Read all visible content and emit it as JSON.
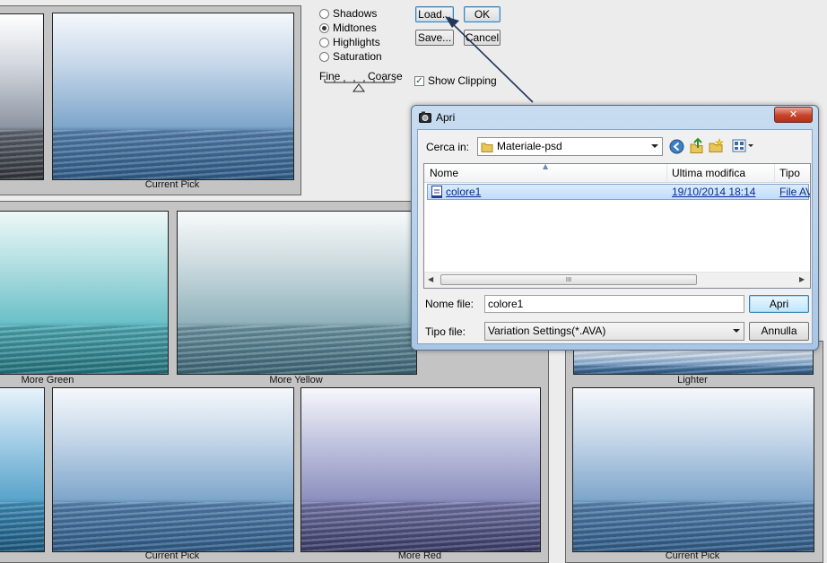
{
  "preview_panels": {
    "top_left_caption": "Current Pick",
    "more_green": "More Green",
    "more_yellow": "More Yellow",
    "lighter": "Lighter",
    "bottom_current_pick": "Current Pick",
    "more_red": "More Red",
    "right_current_pick": "Current Pick"
  },
  "tone_options": [
    {
      "label": "Shadows",
      "selected": false
    },
    {
      "label": "Midtones",
      "selected": true
    },
    {
      "label": "Highlights",
      "selected": false
    },
    {
      "label": "Saturation",
      "selected": false
    }
  ],
  "slider": {
    "left_label": "Fine",
    "right_label": "Coarse"
  },
  "buttons": {
    "load": "Load...",
    "ok": "OK",
    "save": "Save...",
    "cancel": "Cancel"
  },
  "show_clipping": {
    "label": "Show Clipping",
    "checked": true
  },
  "dialog": {
    "title": "Apri",
    "close_glyph": "✕",
    "look_in_label": "Cerca in:",
    "look_in_value": "Materiale-psd",
    "columns": [
      "Nome",
      "Ultima modifica",
      "Tipo"
    ],
    "files": [
      {
        "name": "colore1",
        "modified": "19/10/2014 18:14",
        "type": "File AV"
      }
    ],
    "scroll_grip": "III",
    "filename_label": "Nome file:",
    "filename_value": "colore1",
    "filetype_label": "Tipo file:",
    "filetype_value": "Variation Settings(*.AVA)",
    "open_button": "Apri",
    "cancel_button": "Annulla"
  }
}
